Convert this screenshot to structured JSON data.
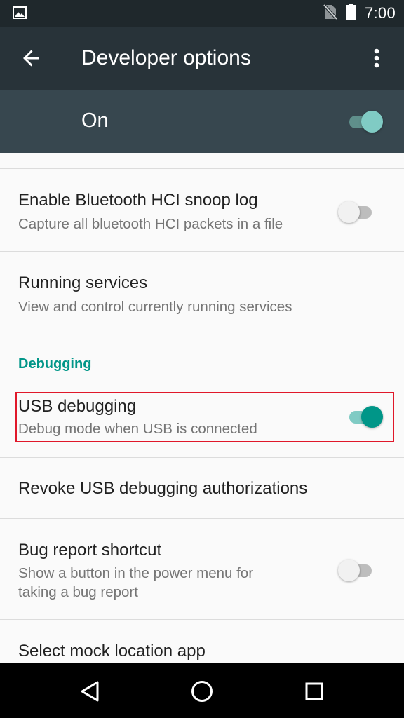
{
  "status_bar": {
    "time": "7:00",
    "icons": [
      "gallery-icon",
      "no-sim-icon",
      "battery-icon"
    ]
  },
  "app_bar": {
    "title": "Developer options",
    "back_icon": "arrow-back-icon",
    "menu_icon": "more-vert-icon"
  },
  "master_switch": {
    "label": "On",
    "checked": true
  },
  "settings": {
    "bt_snoop": {
      "title": "Enable Bluetooth HCI snoop log",
      "summary": "Capture all bluetooth HCI packets in a file",
      "checked": false
    },
    "running_services": {
      "title": "Running services",
      "summary": "View and control currently running services"
    },
    "debugging_header": "Debugging",
    "usb_debugging": {
      "title": "USB debugging",
      "summary": "Debug mode when USB is connected",
      "checked": true
    },
    "revoke_usb": {
      "title": "Revoke USB debugging authorizations"
    },
    "bug_report": {
      "title": "Bug report shortcut",
      "summary_line1": "Show a button in the power menu for",
      "summary_line2": "taking a bug report",
      "checked": false
    },
    "mock_location": {
      "title": "Select mock location app"
    }
  },
  "colors": {
    "accent": "#009688",
    "app_bar": "#283339",
    "master_bar": "#37474f",
    "highlight_box": "#e0182a"
  },
  "nav_bar": {
    "buttons": [
      "back-triangle-icon",
      "home-circle-icon",
      "recents-square-icon"
    ]
  }
}
